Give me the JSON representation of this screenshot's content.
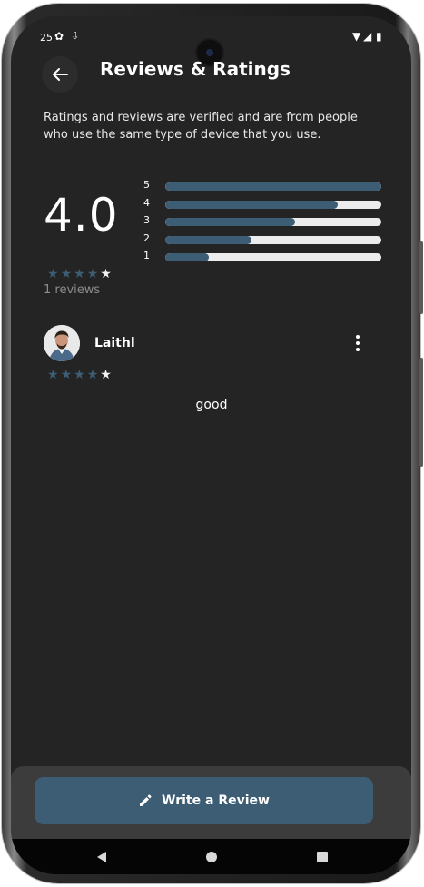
{
  "status_bar": {
    "time": "25",
    "icons": [
      "gear-icon",
      "download-icon",
      "wifi-icon",
      "signal-icon",
      "battery-icon"
    ]
  },
  "header": {
    "back_icon": "arrow-left-icon",
    "title": "Reviews & Ratings"
  },
  "disclaimer": "Ratings and reviews are verified and are from people who use the same type of device that you use.",
  "summary": {
    "average": "4.0",
    "stars_filled": 4,
    "stars_total": 5,
    "count_label": "1 reviews"
  },
  "distribution": [
    {
      "label": "5",
      "fraction": 1.0
    },
    {
      "label": "4",
      "fraction": 0.8
    },
    {
      "label": "3",
      "fraction": 0.6
    },
    {
      "label": "2",
      "fraction": 0.4
    },
    {
      "label": "1",
      "fraction": 0.2
    }
  ],
  "reviews": [
    {
      "name": "Laithl",
      "stars_filled": 4,
      "stars_total": 5,
      "text": "good",
      "menu_icon": "more-vertical-icon"
    }
  ],
  "actions": {
    "write_review_label": "Write a Review",
    "write_review_icon": "pencil-icon"
  },
  "colors": {
    "background": "#242424",
    "accent": "#3d5d74",
    "track": "#ececec",
    "text": "#ffffff",
    "muted": "#8d8d8d"
  },
  "navigation": {
    "buttons": [
      "back-triangle-icon",
      "home-circle-icon",
      "recents-square-icon"
    ]
  }
}
